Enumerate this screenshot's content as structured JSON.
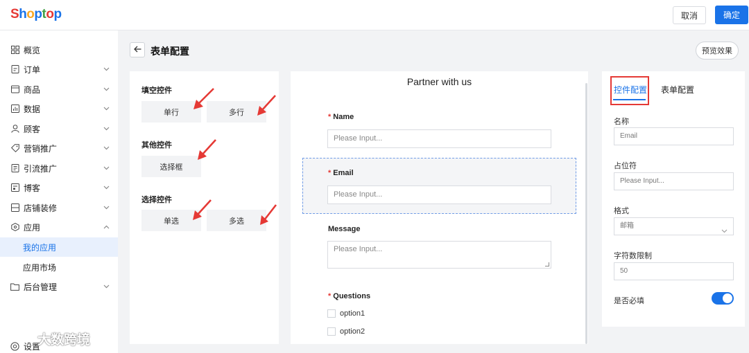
{
  "topbar": {
    "brand_letters": [
      "S",
      "h",
      "o",
      "p",
      "t",
      "o",
      "p"
    ],
    "cancel_label": "取消",
    "confirm_label": "确定"
  },
  "colors": {
    "accent": "#1a73e8",
    "danger": "#e53935",
    "brand": [
      "#e53935",
      "#1a73e8",
      "#f9a825",
      "#1a73e8",
      "#43a047",
      "#e53935",
      "#1a73e8"
    ]
  },
  "sidebar": {
    "items": [
      {
        "label": "概览",
        "icon": "dashboard-icon",
        "expandable": false
      },
      {
        "label": "订单",
        "icon": "order-icon",
        "expandable": true
      },
      {
        "label": "商品",
        "icon": "product-icon",
        "expandable": true
      },
      {
        "label": "数据",
        "icon": "chart-icon",
        "expandable": true
      },
      {
        "label": "顾客",
        "icon": "user-icon",
        "expandable": true
      },
      {
        "label": "营销推广",
        "icon": "tag-icon",
        "expandable": true
      },
      {
        "label": "引流推广",
        "icon": "document-icon",
        "expandable": true
      },
      {
        "label": "博客",
        "icon": "blog-icon",
        "expandable": true
      },
      {
        "label": "店铺装修",
        "icon": "layout-icon",
        "expandable": true
      },
      {
        "label": "应用",
        "icon": "app-icon",
        "expandable": true,
        "expanded": true
      },
      {
        "label": "我的应用",
        "sub": true,
        "active": true
      },
      {
        "label": "应用市场",
        "sub": true
      },
      {
        "label": "后台管理",
        "icon": "folder-icon",
        "expandable": true
      },
      {
        "label": "设置",
        "icon": "settings-icon",
        "expandable": false
      }
    ]
  },
  "header": {
    "title": "表单配置",
    "preview_label": "预览效果"
  },
  "controls": {
    "groups": [
      {
        "title": "填空控件",
        "items": [
          "单行",
          "多行"
        ]
      },
      {
        "title": "其他控件",
        "items": [
          "选择框"
        ]
      },
      {
        "title": "选择控件",
        "items": [
          "单选",
          "多选"
        ]
      }
    ]
  },
  "form": {
    "title": "Partner with us",
    "fields": [
      {
        "label": "Name",
        "required": true,
        "placeholder": "Please Input..."
      },
      {
        "label": "Email",
        "required": true,
        "placeholder": "Please Input...",
        "selected": true
      },
      {
        "label": "Message",
        "required": false,
        "placeholder": "Please Input..."
      },
      {
        "label": "Questions",
        "required": true,
        "options": [
          "option1",
          "option2"
        ]
      }
    ]
  },
  "config": {
    "tabs": [
      "控件配置",
      "表单配置"
    ],
    "active_tab": 0,
    "name_label": "名称",
    "name_value": "Email",
    "placeholder_label": "占位符",
    "placeholder_value": "Please Input...",
    "format_label": "格式",
    "format_value": "邮箱",
    "limit_label": "字符数限制",
    "limit_value": "50",
    "required_label": "是否必填",
    "required_on": true
  },
  "watermark": {
    "text": "大数跨境"
  }
}
